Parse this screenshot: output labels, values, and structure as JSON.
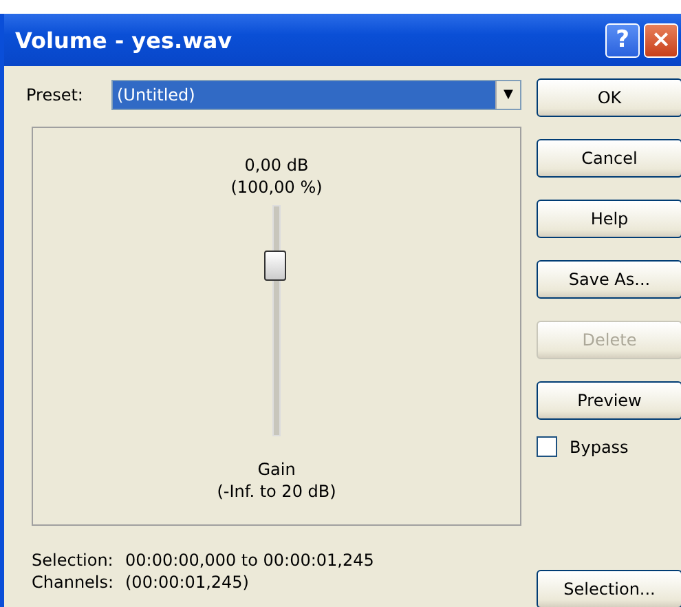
{
  "window": {
    "title": "Volume - yes.wav",
    "help_button": "?",
    "close_button": "×"
  },
  "preset": {
    "label": "Preset:",
    "value": "(Untitled)",
    "arrow": "▼"
  },
  "slider": {
    "value": "0,00 dB",
    "percent": "(100,00 %)",
    "level": 0.74,
    "name": "Gain",
    "range": "(-Inf. to 20 dB)"
  },
  "buttons": [
    {
      "label": "OK",
      "disabled": false
    },
    {
      "label": "Cancel",
      "disabled": false
    },
    {
      "label": "Help",
      "disabled": false
    },
    {
      "label": "Save As...",
      "disabled": false
    },
    {
      "label": "Delete",
      "disabled": true
    },
    {
      "label": "Preview",
      "disabled": false
    }
  ],
  "bypass": {
    "label": "Bypass",
    "checked": false
  },
  "status": [
    {
      "label": "Selection:",
      "value": "00:00:00,000 to 00:00:01,245"
    },
    {
      "label": "Channels:",
      "value": "(00:00:01,245)"
    }
  ],
  "selection_button": {
    "label": "Selection...",
    "disabled": false
  }
}
